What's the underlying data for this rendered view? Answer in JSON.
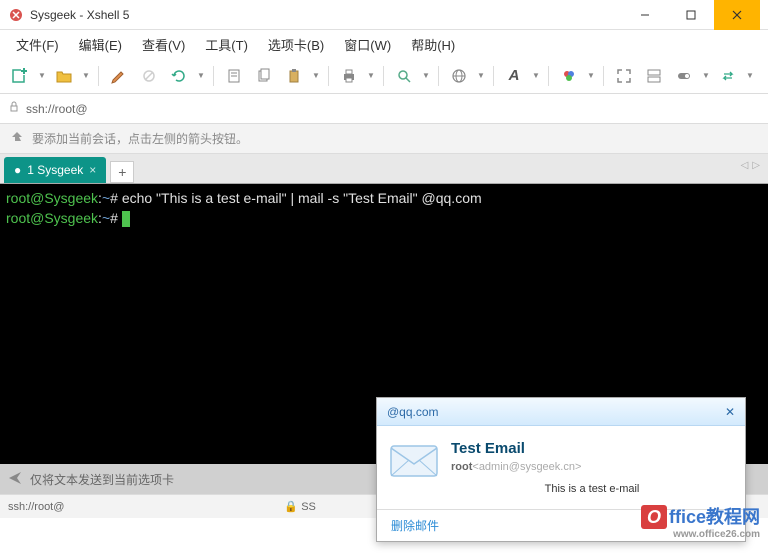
{
  "window": {
    "title": "Sysgeek - Xshell 5",
    "accent_color": "#ffb400"
  },
  "menu": {
    "file": "文件(F)",
    "edit": "编辑(E)",
    "view": "查看(V)",
    "tools": "工具(T)",
    "tabs": "选项卡(B)",
    "window": "窗口(W)",
    "help": "帮助(H)"
  },
  "addressbar": {
    "url": "ssh://root@"
  },
  "hint": {
    "text": "要添加当前会话，点击左侧的箭头按钮。"
  },
  "tabs": {
    "active": "1 Sysgeek"
  },
  "terminal": {
    "lines": [
      {
        "prompt_user": "root@Sysgeek",
        "prompt_path": "~",
        "prompt_symbol": "#",
        "cmd": "echo \"This is a test e-mail\" | mail -s \"Test Email\"       @qq.com"
      },
      {
        "prompt_user": "root@Sysgeek",
        "prompt_path": "~",
        "prompt_symbol": "#",
        "cmd": ""
      }
    ]
  },
  "inputbar": {
    "placeholder": "仅将文本发送到当前选项卡"
  },
  "statusbar": {
    "left": "ssh://root@",
    "ssh": "SS"
  },
  "notify": {
    "from": "@qq.com",
    "subject": "Test Email",
    "sender_name": "root",
    "sender_addr": "<admin@sysgeek.cn>",
    "preview": "This is a test e-mail",
    "delete": "删除邮件"
  },
  "watermark": {
    "brand": "ffice教程网",
    "url": "www.office26.com"
  }
}
